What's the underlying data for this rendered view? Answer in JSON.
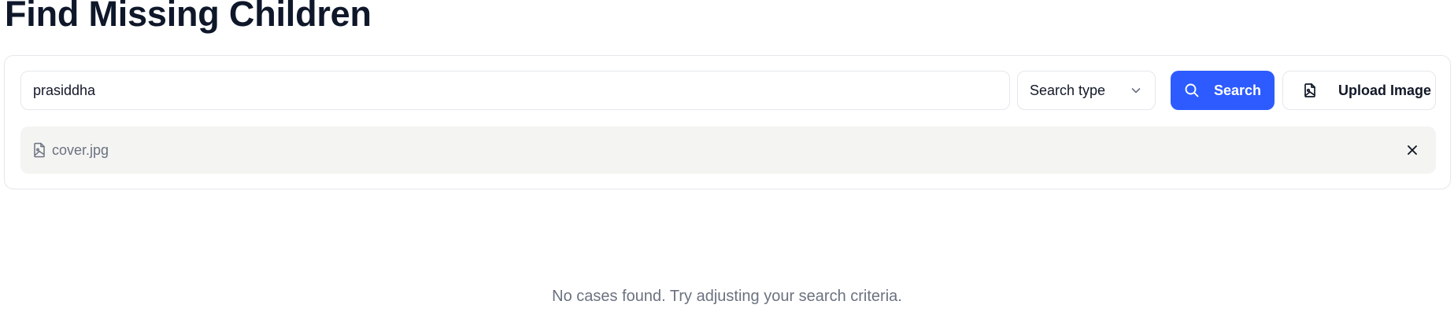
{
  "page": {
    "title": "Find Missing Children"
  },
  "search": {
    "query": "prasiddha",
    "type_placeholder": "Search type",
    "search_label": "Search",
    "upload_label": "Upload Image"
  },
  "attachment": {
    "file_name": "cover.jpg"
  },
  "results": {
    "empty_message": "No cases found. Try adjusting your search criteria."
  },
  "icons": {
    "search": "search-icon",
    "chevron": "chevron-down-icon",
    "upload": "file-image-icon",
    "file": "file-image-icon",
    "remove": "close-icon"
  },
  "colors": {
    "primary": "#2d5bff",
    "chip_bg": "#f4f4f2",
    "muted_text": "#6b7280",
    "heading": "#0f172a"
  }
}
